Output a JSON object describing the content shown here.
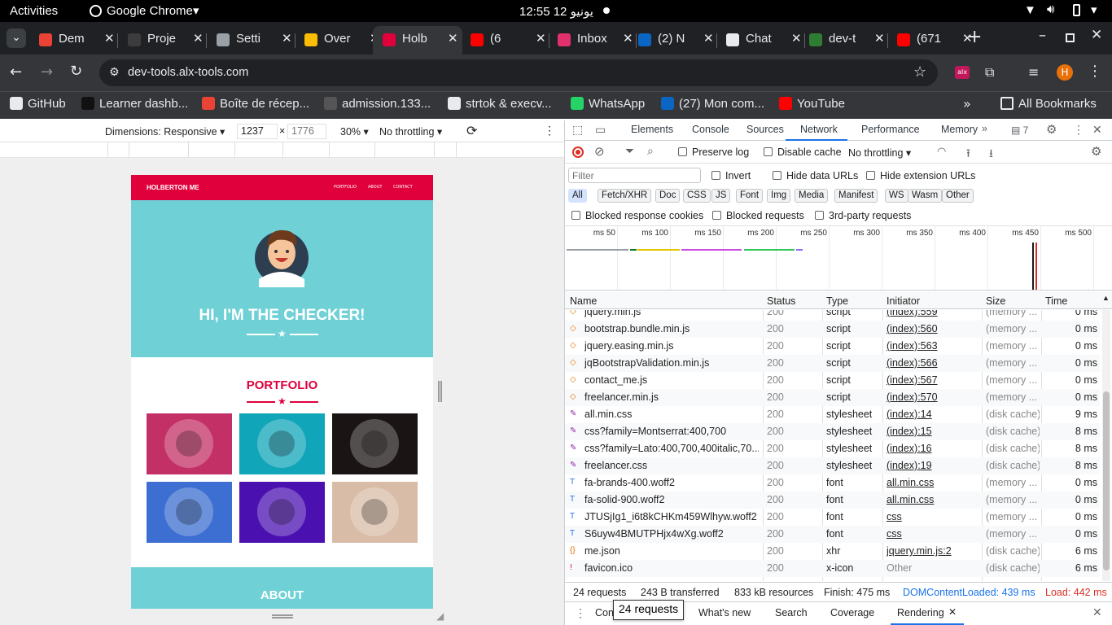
{
  "system": {
    "activities": "Activities",
    "app": "Google Chrome",
    "clock": "12:55  12 يونيو"
  },
  "tabs": [
    {
      "label": "Dem",
      "fav_color": "#ea4335"
    },
    {
      "label": "Proje",
      "fav_color": "#3c3c3c"
    },
    {
      "label": "Setti",
      "fav_color": "#9aa0a6"
    },
    {
      "label": "Over",
      "fav_color": "#fbbc04"
    },
    {
      "label": "Holb",
      "fav_color": "#e0003c"
    },
    {
      "label": "(6",
      "fav_color": "#ff0000"
    },
    {
      "label": "Inbox",
      "fav_color": "#e1306c"
    },
    {
      "label": "(2) N",
      "fav_color": "#0a66c2"
    },
    {
      "label": "Chat",
      "fav_color": "#e8eaed"
    },
    {
      "label": "dev-t",
      "fav_color": "#2e7d32"
    },
    {
      "label": "(671",
      "fav_color": "#ff0000"
    }
  ],
  "omnibox": {
    "url": "dev-tools.alx-tools.com"
  },
  "profile_initial": "H",
  "bookmarks": [
    {
      "label": "GitHub",
      "color": "#e8eaed"
    },
    {
      "label": "Learner dashb...",
      "color": "#111"
    },
    {
      "label": "Boîte de récep...",
      "color": "#ea4335"
    },
    {
      "label": "admission.133...",
      "color": "#555"
    },
    {
      "label": "strtok & execv...",
      "color": "#e8eaed"
    },
    {
      "label": "WhatsApp",
      "color": "#25d366"
    },
    {
      "label": "(27) Mon com...",
      "color": "#0a66c2"
    },
    {
      "label": "YouTube",
      "color": "#ff0000"
    }
  ],
  "bookmarks_all": "All Bookmarks",
  "device_toolbar": {
    "dimensions": "Dimensions: Responsive",
    "width": "1237",
    "height": "1776",
    "times": "×",
    "zoom": "30%",
    "throttle": "No throttling"
  },
  "site": {
    "brand": "HOLBERTON ME",
    "nav": [
      "PORTFOLIO",
      "ABOUT",
      "CONTACT"
    ],
    "hero_title": "HI, I'M THE CHECKER!",
    "portfolio_title": "PORTFOLIO",
    "about_title": "ABOUT",
    "tiles": [
      {
        "bg": "#c33065",
        "icon": "cabin"
      },
      {
        "bg": "#10a5b8",
        "icon": "cake"
      },
      {
        "bg": "#1b1414",
        "icon": "circus"
      },
      {
        "bg": "#3d6ed1",
        "icon": "controller"
      },
      {
        "bg": "#4b11b0",
        "icon": "safe"
      },
      {
        "bg": "#d8bca7",
        "icon": "submarine"
      }
    ]
  },
  "devtools": {
    "panels": [
      "Elements",
      "Console",
      "Sources",
      "Network",
      "Performance",
      "Memory"
    ],
    "issues_count": "7",
    "preserve_log": "Preserve log",
    "disable_cache": "Disable cache",
    "throttling": "No throttling",
    "filter_placeholder": "Filter",
    "invert": "Invert",
    "hide_data": "Hide data URLs",
    "hide_ext": "Hide extension URLs",
    "type_filters": [
      "All",
      "Fetch/XHR",
      "Doc",
      "CSS",
      "JS",
      "Font",
      "Img",
      "Media",
      "Manifest",
      "WS",
      "Wasm",
      "Other"
    ],
    "blocked_cookies": "Blocked response cookies",
    "blocked_requests": "Blocked requests",
    "third_party": "3rd-party requests",
    "timeline_ticks": [
      "50 ms",
      "100 ms",
      "150 ms",
      "200 ms",
      "250 ms",
      "300 ms",
      "350 ms",
      "400 ms",
      "450 ms",
      "500 ms"
    ],
    "columns": [
      "Name",
      "Status",
      "Type",
      "Initiator",
      "Size",
      "Time"
    ],
    "rows": [
      {
        "name": "jquery.min.js",
        "status": "200",
        "type": "script",
        "initiator": "(index):559",
        "size": "(memory ...",
        "time": "0 ms",
        "kind": "js"
      },
      {
        "name": "bootstrap.bundle.min.js",
        "status": "200",
        "type": "script",
        "initiator": "(index):560",
        "size": "(memory ...",
        "time": "0 ms",
        "kind": "js"
      },
      {
        "name": "jquery.easing.min.js",
        "status": "200",
        "type": "script",
        "initiator": "(index):563",
        "size": "(memory ...",
        "time": "0 ms",
        "kind": "js"
      },
      {
        "name": "jqBootstrapValidation.min.js",
        "status": "200",
        "type": "script",
        "initiator": "(index):566",
        "size": "(memory ...",
        "time": "0 ms",
        "kind": "js"
      },
      {
        "name": "contact_me.js",
        "status": "200",
        "type": "script",
        "initiator": "(index):567",
        "size": "(memory ...",
        "time": "0 ms",
        "kind": "js"
      },
      {
        "name": "freelancer.min.js",
        "status": "200",
        "type": "script",
        "initiator": "(index):570",
        "size": "(memory ...",
        "time": "0 ms",
        "kind": "js"
      },
      {
        "name": "all.min.css",
        "status": "200",
        "type": "stylesheet",
        "initiator": "(index):14",
        "size": "(disk cache)",
        "time": "9 ms",
        "kind": "css"
      },
      {
        "name": "css?family=Montserrat:400,700",
        "status": "200",
        "type": "stylesheet",
        "initiator": "(index):15",
        "size": "(disk cache)",
        "time": "8 ms",
        "kind": "css"
      },
      {
        "name": "css?family=Lato:400,700,400italic,70...",
        "status": "200",
        "type": "stylesheet",
        "initiator": "(index):16",
        "size": "(disk cache)",
        "time": "8 ms",
        "kind": "css"
      },
      {
        "name": "freelancer.css",
        "status": "200",
        "type": "stylesheet",
        "initiator": "(index):19",
        "size": "(disk cache)",
        "time": "8 ms",
        "kind": "css"
      },
      {
        "name": "fa-brands-400.woff2",
        "status": "200",
        "type": "font",
        "initiator": "all.min.css",
        "size": "(memory ...",
        "time": "0 ms",
        "kind": "font"
      },
      {
        "name": "fa-solid-900.woff2",
        "status": "200",
        "type": "font",
        "initiator": "all.min.css",
        "size": "(memory ...",
        "time": "0 ms",
        "kind": "font"
      },
      {
        "name": "JTUSjIg1_i6t8kCHKm459Wlhyw.woff2",
        "status": "200",
        "type": "font",
        "initiator": "css",
        "size": "(memory ...",
        "time": "0 ms",
        "kind": "font"
      },
      {
        "name": "S6uyw4BMUTPHjx4wXg.woff2",
        "status": "200",
        "type": "font",
        "initiator": "css",
        "size": "(memory ...",
        "time": "0 ms",
        "kind": "font"
      },
      {
        "name": "me.json",
        "status": "200",
        "type": "xhr",
        "initiator": "jquery.min.js:2",
        "size": "(disk cache)",
        "time": "6 ms",
        "kind": "xhr"
      },
      {
        "name": "favicon.ico",
        "status": "200",
        "type": "x-icon",
        "initiator": "Other",
        "size": "(disk cache)",
        "time": "6 ms",
        "kind": "ico"
      }
    ],
    "summary": {
      "requests": "24 requests",
      "transferred": "243 B transferred",
      "resources": "833 kB resources",
      "finish": "Finish: 475 ms",
      "dcl": "DOMContentLoaded: 439 ms",
      "load": "Load: 442 ms"
    },
    "tooltip": "24 requests",
    "drawer_tabs": [
      "Con",
      "What's new",
      "Search",
      "Coverage",
      "Rendering"
    ]
  }
}
